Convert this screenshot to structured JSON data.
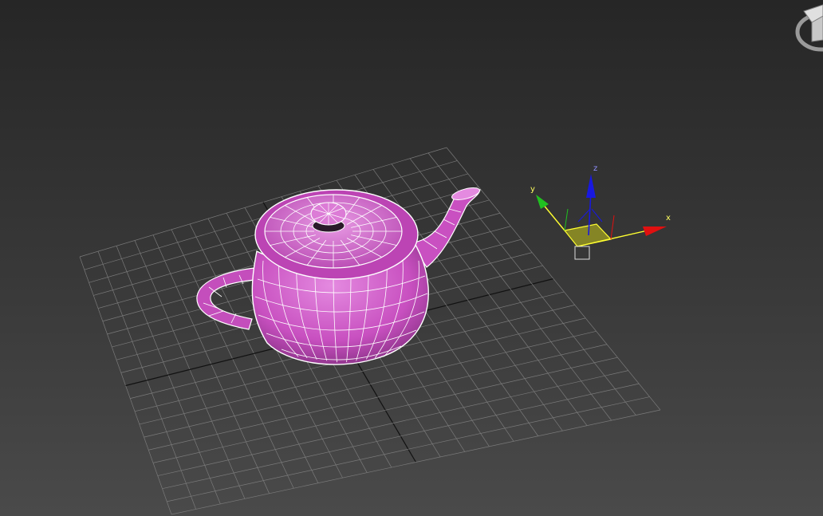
{
  "viewport": {
    "background_top": "#262626",
    "background_bottom": "#4a4a4a"
  },
  "grid": {
    "line_color": "#7a7a7a",
    "home_axis_color": "#111111"
  },
  "teapot": {
    "fill_color": "#c850c0",
    "highlight_color": "#e48ae0",
    "wire_color": "#ffffff"
  },
  "gizmo": {
    "x_label": "x",
    "y_label": "y",
    "z_label": "z",
    "x_color": "#e01010",
    "y_color": "#20c020",
    "z_color": "#1818e0",
    "plane_color": "#a0a020",
    "active_axis_color": "#ffff30"
  },
  "viewcube": {
    "icon": "viewcube-icon",
    "color": "#b0b0b0"
  }
}
